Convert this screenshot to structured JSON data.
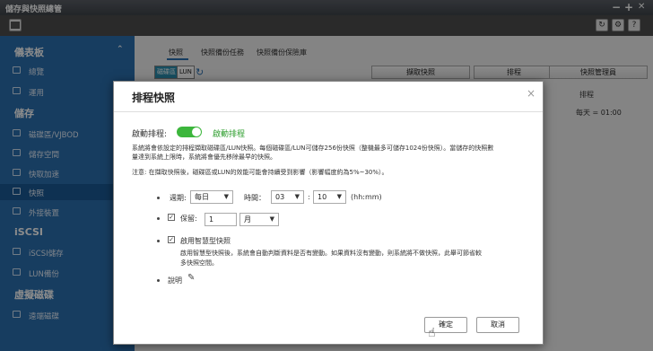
{
  "window": {
    "title": "儲存與快照總管",
    "min": "−",
    "max": "+",
    "close": "✕"
  },
  "toolbar": {
    "refresh_icon": "↻",
    "settings_icon": "⚙",
    "help_icon": "?"
  },
  "sidebar": {
    "sections": [
      {
        "title": "儀表板",
        "chevron": "⌃"
      },
      {
        "title": "儲存"
      },
      {
        "title": "iSCSI"
      },
      {
        "title": "虛擬磁碟"
      }
    ],
    "items": [
      {
        "label": "總覽"
      },
      {
        "label": "運用"
      },
      {
        "label": "磁碟區/VJBOD"
      },
      {
        "label": "儲存空間"
      },
      {
        "label": "快取加速"
      },
      {
        "label": "快照"
      },
      {
        "label": "外接裝置"
      },
      {
        "label": "iSCSI儲存"
      },
      {
        "label": "LUN備份"
      },
      {
        "label": "遠端磁碟"
      }
    ]
  },
  "main": {
    "tabs": [
      {
        "label": "快照"
      },
      {
        "label": "快照備份任務"
      },
      {
        "label": "快照備份保險庫"
      }
    ],
    "seg_volume": "磁碟區",
    "seg_lun": "LUN",
    "buttons": {
      "take": "擷取快照",
      "schedule": "排程",
      "manager": "快照管理員"
    },
    "col_schedule": "排程",
    "schedule_value": "每天 = 01:00"
  },
  "dialog": {
    "title": "排程快照",
    "close_icon": "×",
    "enable_label": "啟動排程:",
    "enable_status": "啟動排程",
    "desc1": "系統將會依設定的排程擷取磁碟區/LUN快照。每個磁碟區/LUN可儲存256份快照（整機最多可儲存1024份快照）。當儲存的快照數",
    "desc2": "量達到系統上限時，系統將會優先移除最早的快照。",
    "note": "注意: 在擷取快照後，磁碟區或LUN的效能可能會持續受到影響（影響幅度約為5%~30%）。",
    "period_label": "週期:",
    "period_value": "每日",
    "time_label": "時間：",
    "hour_value": "03",
    "minute_value": "10",
    "time_unit": "(hh:mm)",
    "retain_label": "保留:",
    "retain_value": "1",
    "retain_unit": "月",
    "smart_title": "啟用智慧型快照",
    "smart_desc1": "啟用智慧型快照後，系統會自動判斷資料是否有變動。如果資料沒有變動，則系統將不做快照，此舉可節省較",
    "smart_desc2": "多快照空間。",
    "memo_label": "說明",
    "ok": "確定",
    "cancel": "取消"
  }
}
